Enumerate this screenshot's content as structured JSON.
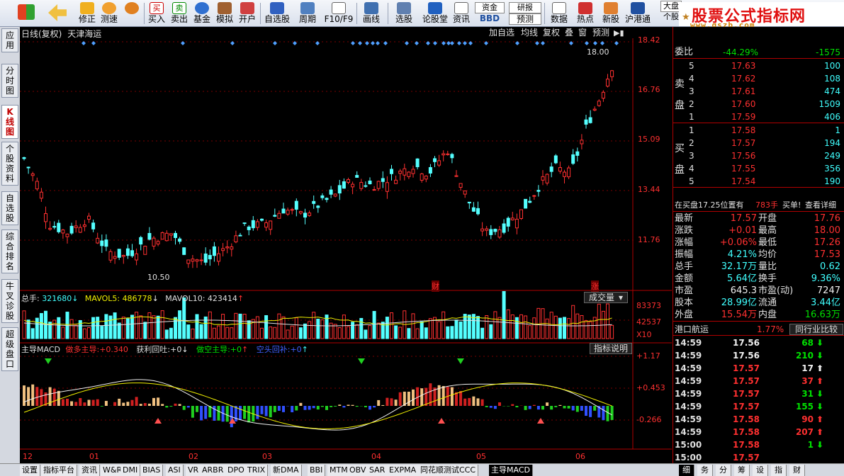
{
  "toolbar": {
    "items": [
      {
        "label": "",
        "icon": "windows-icon"
      },
      {
        "label": "",
        "icon": "back-arrow-icon"
      },
      {
        "label": "修正",
        "icon": "up-down-icon"
      },
      {
        "label": "测速",
        "icon": "clock-icon"
      },
      {
        "label": "买入",
        "icon": "buy-icon"
      },
      {
        "label": "卖出",
        "icon": "sell-icon"
      },
      {
        "label": "基金",
        "icon": "fund-icon"
      },
      {
        "label": "模拟",
        "icon": "hammer-icon"
      },
      {
        "label": "开户",
        "icon": "account-icon"
      },
      {
        "label": "自选股",
        "icon": "star-icon"
      },
      {
        "label": "周期",
        "icon": "period-icon"
      },
      {
        "label": "F10/F9",
        "icon": "f10-icon"
      },
      {
        "label": "画线",
        "icon": "pen-icon"
      },
      {
        "label": "选股",
        "icon": "select-icon"
      },
      {
        "label": "论股堂",
        "icon": "forum-icon"
      },
      {
        "label": "资讯",
        "icon": "news-icon"
      },
      {
        "label": "BBD",
        "icon": "bbd-icon"
      },
      {
        "label": "预测",
        "icon": "forecast-icon"
      },
      {
        "label": "数据",
        "icon": "data-icon"
      },
      {
        "label": "热点",
        "icon": "hot-icon"
      },
      {
        "label": "新股",
        "icon": "newstock-icon"
      },
      {
        "label": "沪港通",
        "icon": "hk-icon"
      },
      {
        "label": "个股",
        "icon": "stock-icon"
      }
    ],
    "small_labels": {
      "fund": "资金",
      "report": "研报",
      "big": "大盘"
    }
  },
  "logo": {
    "title": "股票公式指标网",
    "url": "www.gszb.com"
  },
  "left_tabs": [
    {
      "label": "应用",
      "active": false
    },
    {
      "label": "分时图",
      "active": false
    },
    {
      "label": "K线图",
      "active": true
    },
    {
      "label": "个股资料",
      "active": false
    },
    {
      "label": "自选股",
      "active": false
    },
    {
      "label": "综合排名",
      "active": false
    },
    {
      "label": "牛叉诊股",
      "active": false
    },
    {
      "label": "超级盘口",
      "active": false
    }
  ],
  "chart_header": {
    "title": "日线(复权)",
    "stock": "天津海运",
    "buttons": [
      "加自选",
      "均线",
      "复权",
      "叠",
      "窗",
      "预测"
    ]
  },
  "main_axis": [
    "18.42",
    "16.76",
    "15.09",
    "13.44",
    "11.76"
  ],
  "annotations": {
    "high": "18.00",
    "low": "10.50",
    "tag_cai": "财",
    "tag_zhang": "涨"
  },
  "volume_panel": {
    "label": "总手",
    "value": "321680",
    "mavol5_label": "MAVOL5",
    "mavol5": "486778",
    "mavol10_label": "MAVOL10",
    "mavol10": "423414",
    "dropdown": "成交量",
    "axis": [
      "83373",
      "42537",
      "X10"
    ]
  },
  "macd_panel": {
    "label": "主导MACD",
    "items": [
      {
        "text": "做多主导:",
        "value": "+0.340",
        "color": "#ff3030"
      },
      {
        "text": "获利回吐:",
        "value": "+0",
        "color": "#e0e0e0"
      },
      {
        "text": "做空主导:",
        "value": "+0",
        "color": "#00e000"
      },
      {
        "text": "空头回补:",
        "value": "+0",
        "color": "#4060ff"
      }
    ],
    "help": "指标说明",
    "axis": [
      "+1.17",
      "+0.453",
      "-0.266"
    ]
  },
  "x_axis": [
    "12",
    "01",
    "02",
    "03",
    "04",
    "05",
    "06"
  ],
  "order_book": {
    "weibi_label": "委比",
    "weibi": "-44.29%",
    "weicha": "-1575",
    "sell_label": "卖盘",
    "buy_label": "买盘",
    "sell": [
      {
        "lvl": "5",
        "price": "17.63",
        "vol": "100"
      },
      {
        "lvl": "4",
        "price": "17.62",
        "vol": "108"
      },
      {
        "lvl": "3",
        "price": "17.61",
        "vol": "474"
      },
      {
        "lvl": "2",
        "price": "17.60",
        "vol": "1509"
      },
      {
        "lvl": "1",
        "price": "17.59",
        "vol": "406"
      }
    ],
    "buy": [
      {
        "lvl": "1",
        "price": "17.58",
        "vol": "1"
      },
      {
        "lvl": "2",
        "price": "17.57",
        "vol": "194"
      },
      {
        "lvl": "3",
        "price": "17.56",
        "vol": "249"
      },
      {
        "lvl": "4",
        "price": "17.55",
        "vol": "356"
      },
      {
        "lvl": "5",
        "price": "17.54",
        "vol": "190"
      }
    ],
    "notice": "在买盘17.25位置有",
    "notice_vol": "783手",
    "notice_tail": "买单!",
    "notice_link": "查看详细"
  },
  "quote": [
    {
      "k1": "最新",
      "v1": "17.57",
      "c1": "red",
      "k2": "开盘",
      "v2": "17.76",
      "c2": "red"
    },
    {
      "k1": "涨跌",
      "v1": "+0.01",
      "c1": "red",
      "k2": "最高",
      "v2": "18.00",
      "c2": "red"
    },
    {
      "k1": "涨幅",
      "v1": "+0.06%",
      "c1": "red",
      "k2": "最低",
      "v2": "17.26",
      "c2": "red"
    },
    {
      "k1": "振幅",
      "v1": "4.21%",
      "c1": "cyn",
      "k2": "均价",
      "v2": "17.53",
      "c2": "red"
    },
    {
      "k1": "总手",
      "v1": "32.17万",
      "c1": "cyn",
      "k2": "量比",
      "v2": "0.62",
      "c2": "cyn"
    },
    {
      "k1": "金额",
      "v1": "5.64亿",
      "c1": "cyn",
      "k2": "换手",
      "v2": "9.36%",
      "c2": "cyn"
    },
    {
      "k1": "市盈",
      "v1": "645.3",
      "c1": "wht",
      "k2": "市盈(动)",
      "v2": "7247",
      "c2": "wht"
    },
    {
      "k1": "股本",
      "v1": "28.99亿",
      "c1": "cyn",
      "k2": "流通",
      "v2": "3.44亿",
      "c2": "cyn"
    },
    {
      "k1": "外盘",
      "v1": "15.54万",
      "c1": "red",
      "k2": "内盘",
      "v2": "16.63万",
      "c2": "grn"
    }
  ],
  "sector": {
    "name": "港口航运",
    "change": "1.77%",
    "compare": "同行业比较"
  },
  "ticks": [
    {
      "time": "14:59",
      "price": "17.56",
      "pc": "wht",
      "vol": "68",
      "dir": "down"
    },
    {
      "time": "14:59",
      "price": "17.56",
      "pc": "wht",
      "vol": "210",
      "dir": "down"
    },
    {
      "time": "14:59",
      "price": "17.57",
      "pc": "red",
      "vol": "17",
      "dir": "up-white"
    },
    {
      "time": "14:59",
      "price": "17.57",
      "pc": "red",
      "vol": "37",
      "dir": "up"
    },
    {
      "time": "14:59",
      "price": "17.57",
      "pc": "red",
      "vol": "31",
      "dir": "down"
    },
    {
      "time": "14:59",
      "price": "17.57",
      "pc": "red",
      "vol": "155",
      "dir": "down"
    },
    {
      "time": "14:59",
      "price": "17.58",
      "pc": "red",
      "vol": "90",
      "dir": "up"
    },
    {
      "time": "14:59",
      "price": "17.58",
      "pc": "red",
      "vol": "207",
      "dir": "up"
    },
    {
      "time": "15:00",
      "price": "17.58",
      "pc": "red",
      "vol": "1",
      "dir": "down"
    },
    {
      "time": "15:00",
      "price": "17.57",
      "pc": "red",
      "vol": "",
      "dir": ""
    }
  ],
  "bottom_tabs": [
    "设置",
    "指标平台",
    "资讯",
    "W&R",
    "DMI",
    "BIAS",
    "ASI",
    "VR",
    "ARBR",
    "DPO",
    "TRIX",
    "新DMA",
    "BBI",
    "MTM",
    "OBV",
    "SAR",
    "EXPMA",
    "同花顺测试CCC",
    "主导MACD"
  ],
  "bottom_right_tabs": [
    "细",
    "务",
    "分",
    "筹",
    "设",
    "指",
    "财"
  ]
}
